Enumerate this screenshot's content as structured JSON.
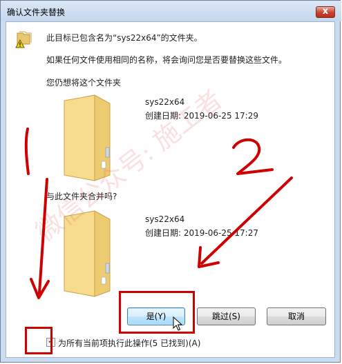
{
  "window": {
    "title": "确认文件夹替换",
    "close_glyph": "x"
  },
  "message": {
    "line1": "此目标已包含名为“sys22x64”的文件夹。",
    "line2": "如果任何文件使用相同的名称，将会询问您是否要替换这些文件。",
    "line3": "您仍想将这个文件夹"
  },
  "target_folder": {
    "name": "sys22x64",
    "created": "创建日期: 2019-06-25 17:29"
  },
  "merge_prompt": "与此文件夹合并吗?",
  "source_folder": {
    "name": "sys22x64",
    "created": "创建日期: 2019-06-25 17:27"
  },
  "buttons": {
    "yes": "是(Y)",
    "skip": "跳过(S)",
    "cancel": "取消"
  },
  "apply_all": {
    "checked": true,
    "label": "为所有当前项执行此操作(5 已找到)(A)"
  },
  "annotations": {
    "number_one": "1",
    "number_two": "2",
    "watermark": "微信公众号: 施工者"
  },
  "colors": {
    "annotation_red": "#d00000",
    "title_bar": "#c4d7ee",
    "folder_yellow": "#f3d67c"
  }
}
